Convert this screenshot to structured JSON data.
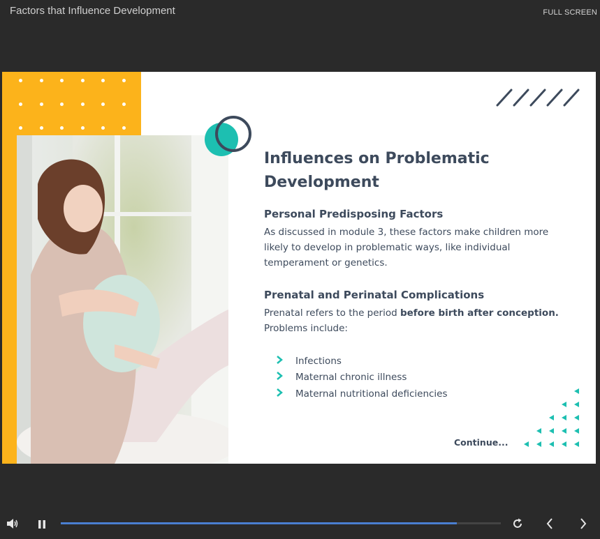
{
  "header": {
    "title": "Factors that Influence Development",
    "fullscreen_label": "FULL SCREEN"
  },
  "slide": {
    "heading": "Influences on Problematic Development",
    "section1": {
      "title": "Personal Predisposing Factors",
      "body": "As discussed in module 3, these factors make children more likely to develop in problematic ways, like individual temperament or genetics."
    },
    "section2": {
      "title": "Prenatal and Perinatal Complications",
      "body_prefix": "Prenatal refers to the period ",
      "body_bold": "before birth after conception.",
      "body_suffix": " Problems include:",
      "bullets": [
        "Infections",
        "Maternal chronic illness",
        "Maternal nutritional deficiencies"
      ]
    },
    "continue_label": "Continue...",
    "image_alt": "pregnant woman"
  },
  "player": {
    "progress": 0.9
  },
  "colors": {
    "accent_yellow": "#fcb31b",
    "accent_teal": "#1dbfb1",
    "text_dark": "#3d4a5c",
    "progress_blue": "#4a7fd1"
  },
  "icons": {
    "volume": "volume-icon",
    "pause": "pause-icon",
    "replay": "replay-icon",
    "prev": "chevron-left-icon",
    "next": "chevron-right-icon"
  }
}
